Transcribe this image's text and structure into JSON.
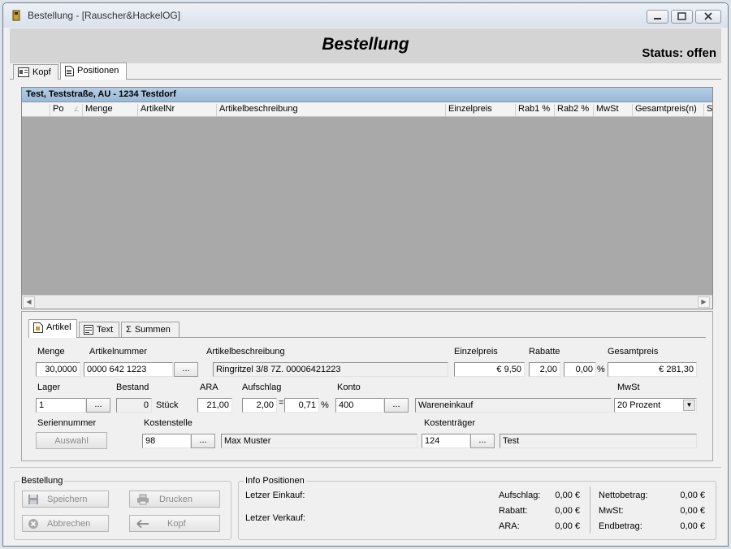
{
  "window": {
    "title": "Bestellung - [Rauscher&HackelOG]"
  },
  "header": {
    "title": "Bestellung",
    "status": "Status: offen"
  },
  "main_tabs": [
    {
      "label": "Kopf"
    },
    {
      "label": "Positionen"
    }
  ],
  "grid": {
    "caption": "Test, Teststraße, AU - 1234 Testdorf",
    "columns": [
      "Po",
      "Menge",
      "ArtikelNr",
      "Artikelbeschreibung",
      "Einzelpreis",
      "Rab1 %",
      "Rab2 %",
      "MwSt",
      "Gesamtpreis(n)",
      "S"
    ]
  },
  "detail_tabs": [
    {
      "label": "Artikel"
    },
    {
      "label": "Text"
    },
    {
      "label": "Summen"
    }
  ],
  "artikel": {
    "menge_label": "Menge",
    "menge": "30,0000",
    "artikelnummer_label": "Artikelnummer",
    "artikelnummer": "0000 642 1223",
    "artikelbeschreibung_label": "Artikelbeschreibung",
    "artikelbeschreibung": "Ringritzel 3/8 7Z. 00006421223",
    "einzelpreis_label": "Einzelpreis",
    "einzelpreis": "€ 9,50",
    "rabatte_label": "Rabatte",
    "rabatt1": "2,00",
    "rabatt2": "0,00",
    "percent_sign": "%",
    "gesamtpreis_label": "Gesamtpreis",
    "gesamtpreis": "€ 281,30",
    "lager_label": "Lager",
    "lager": "1",
    "bestand_label": "Bestand",
    "bestand": "0",
    "bestand_unit": "Stück",
    "ara_label": "ARA",
    "ara": "21,00",
    "aufschlag_label": "Aufschlag",
    "aufschlag1": "2,00",
    "equals_sign": "=",
    "aufschlag2": "0,71",
    "aufschlag_percent": "%",
    "konto_label": "Konto",
    "konto": "400",
    "konto_name": "Wareneinkauf",
    "mwst_label": "MwSt",
    "mwst": "20 Prozent",
    "seriennummer_label": "Seriennummer",
    "auswahl_button": "Auswahl",
    "kostenstelle_label": "Kostenstelle",
    "kostenstelle": "98",
    "kostenstelle_name": "Max Muster",
    "kostentraeger_label": "Kostenträger",
    "kostentraeger": "124",
    "kostentraeger_name": "Test",
    "dots": "..."
  },
  "bestellung_group": {
    "legend": "Bestellung",
    "speichern": "Speichern",
    "drucken": "Drucken",
    "abbrechen": "Abbrechen",
    "kopf": "Kopf"
  },
  "info": {
    "legend": "Info Positionen",
    "letzter_einkauf_label": "Letzer Einkauf:",
    "letzter_verkauf_label": "Letzer Verkauf:",
    "aufschlag_label": "Aufschlag:",
    "aufschlag": "0,00 €",
    "rabatt_label": "Rabatt:",
    "rabatt": "0,00 €",
    "ara_label": "ARA:",
    "ara": "0,00 €",
    "netto_label": "Nettobetrag:",
    "netto": "0,00 €",
    "mwst_label": "MwSt:",
    "mwst": "0,00 €",
    "end_label": "Endbetrag:",
    "end": "0,00 €"
  }
}
